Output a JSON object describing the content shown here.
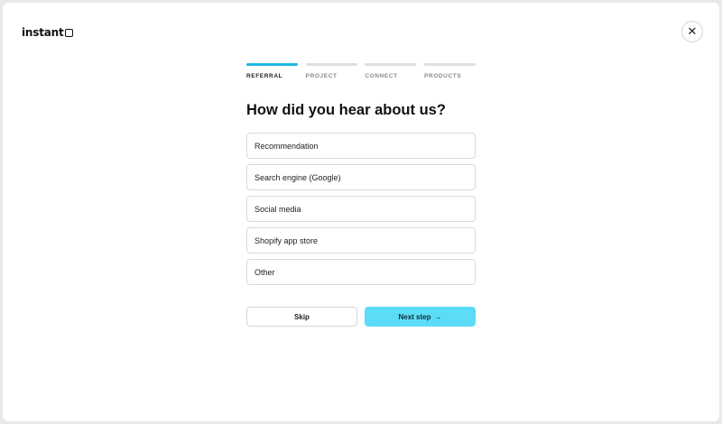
{
  "brand": {
    "name": "instant"
  },
  "close": {
    "icon": "close-icon",
    "glyph": "✕"
  },
  "steps": [
    {
      "label": "REFERRAL",
      "active": true
    },
    {
      "label": "PROJECT",
      "active": false
    },
    {
      "label": "CONNECT",
      "active": false
    },
    {
      "label": "PRODUCTS",
      "active": false
    }
  ],
  "question": "How did you hear about us?",
  "options": [
    "Recommendation",
    "Search engine (Google)",
    "Social media",
    "Shopify app store",
    "Other"
  ],
  "actions": {
    "skip_label": "Skip",
    "next_label": "Next step",
    "next_arrow": "→"
  },
  "colors": {
    "accent": "#20b8e4",
    "next_button": "#5cdcf7"
  }
}
